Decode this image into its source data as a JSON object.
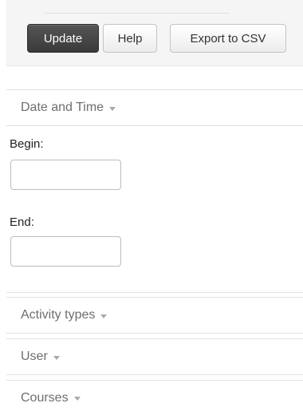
{
  "toolbar": {
    "update_label": "Update",
    "help_label": "Help",
    "export_label": "Export to CSV"
  },
  "sections": {
    "datetime": {
      "title": "Date and Time",
      "begin_label": "Begin:",
      "begin_value": "",
      "end_label": "End:",
      "end_value": ""
    },
    "activity_types": {
      "title": "Activity types"
    },
    "user": {
      "title": "User"
    },
    "courses": {
      "title": "Courses"
    }
  },
  "colors": {
    "primary_button": "#444444",
    "toolbar_bg": "#f5f5f5",
    "divider": "#e2e2e2",
    "header_text": "#6e6e6e"
  }
}
